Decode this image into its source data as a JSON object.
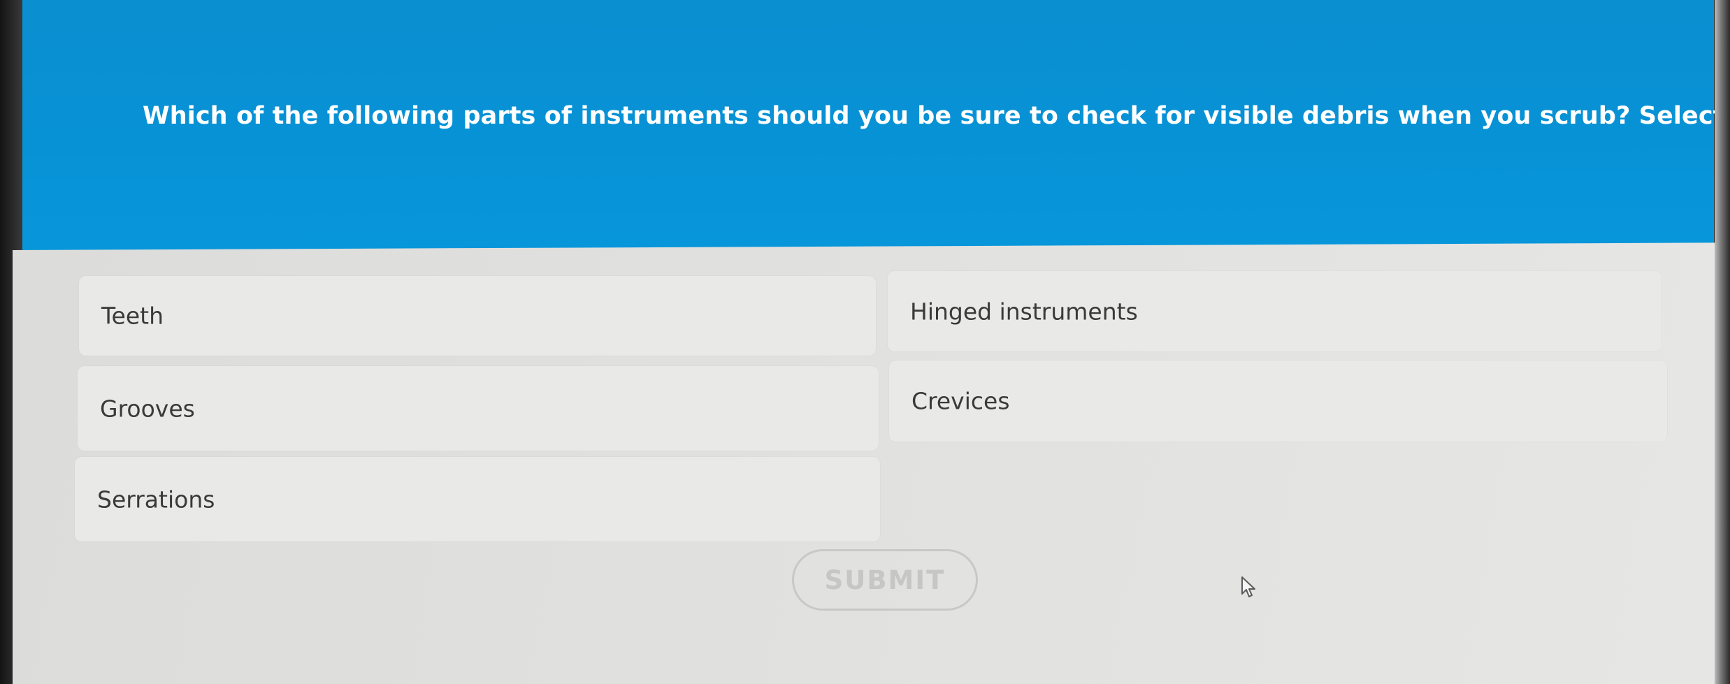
{
  "question": {
    "text": "Which of the following parts of instruments should you be sure to check for visible debris when you scrub? Select all that apply."
  },
  "options": [
    {
      "label": "Teeth"
    },
    {
      "label": "Hinged instruments"
    },
    {
      "label": "Grooves"
    },
    {
      "label": "Crevices"
    },
    {
      "label": "Serrations"
    }
  ],
  "submit": {
    "label": "SUBMIT"
  },
  "colors": {
    "banner": "#0892d6",
    "question_text": "#ffffff",
    "option_background": "#e9e9e7",
    "option_text": "#3a3a3a",
    "submit_disabled": "#c6c6c4"
  },
  "icons": {
    "cursor": "mouse-pointer-icon"
  }
}
